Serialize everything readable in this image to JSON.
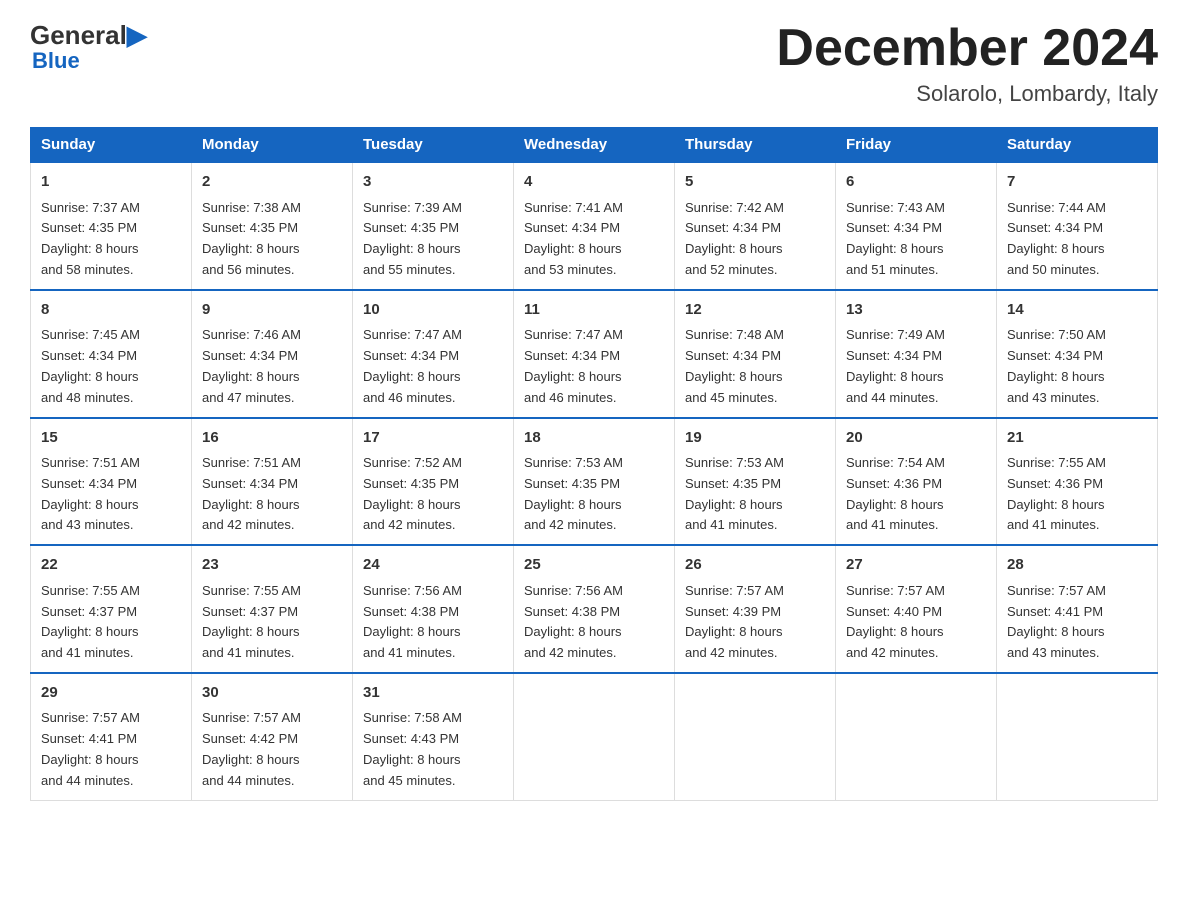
{
  "header": {
    "logo_general": "General",
    "logo_blue": "Blue",
    "month_title": "December 2024",
    "location": "Solarolo, Lombardy, Italy"
  },
  "days_of_week": [
    "Sunday",
    "Monday",
    "Tuesday",
    "Wednesday",
    "Thursday",
    "Friday",
    "Saturday"
  ],
  "weeks": [
    [
      {
        "day": "1",
        "sunrise": "7:37 AM",
        "sunset": "4:35 PM",
        "daylight": "8 hours and 58 minutes."
      },
      {
        "day": "2",
        "sunrise": "7:38 AM",
        "sunset": "4:35 PM",
        "daylight": "8 hours and 56 minutes."
      },
      {
        "day": "3",
        "sunrise": "7:39 AM",
        "sunset": "4:35 PM",
        "daylight": "8 hours and 55 minutes."
      },
      {
        "day": "4",
        "sunrise": "7:41 AM",
        "sunset": "4:34 PM",
        "daylight": "8 hours and 53 minutes."
      },
      {
        "day": "5",
        "sunrise": "7:42 AM",
        "sunset": "4:34 PM",
        "daylight": "8 hours and 52 minutes."
      },
      {
        "day": "6",
        "sunrise": "7:43 AM",
        "sunset": "4:34 PM",
        "daylight": "8 hours and 51 minutes."
      },
      {
        "day": "7",
        "sunrise": "7:44 AM",
        "sunset": "4:34 PM",
        "daylight": "8 hours and 50 minutes."
      }
    ],
    [
      {
        "day": "8",
        "sunrise": "7:45 AM",
        "sunset": "4:34 PM",
        "daylight": "8 hours and 48 minutes."
      },
      {
        "day": "9",
        "sunrise": "7:46 AM",
        "sunset": "4:34 PM",
        "daylight": "8 hours and 47 minutes."
      },
      {
        "day": "10",
        "sunrise": "7:47 AM",
        "sunset": "4:34 PM",
        "daylight": "8 hours and 46 minutes."
      },
      {
        "day": "11",
        "sunrise": "7:47 AM",
        "sunset": "4:34 PM",
        "daylight": "8 hours and 46 minutes."
      },
      {
        "day": "12",
        "sunrise": "7:48 AM",
        "sunset": "4:34 PM",
        "daylight": "8 hours and 45 minutes."
      },
      {
        "day": "13",
        "sunrise": "7:49 AM",
        "sunset": "4:34 PM",
        "daylight": "8 hours and 44 minutes."
      },
      {
        "day": "14",
        "sunrise": "7:50 AM",
        "sunset": "4:34 PM",
        "daylight": "8 hours and 43 minutes."
      }
    ],
    [
      {
        "day": "15",
        "sunrise": "7:51 AM",
        "sunset": "4:34 PM",
        "daylight": "8 hours and 43 minutes."
      },
      {
        "day": "16",
        "sunrise": "7:51 AM",
        "sunset": "4:34 PM",
        "daylight": "8 hours and 42 minutes."
      },
      {
        "day": "17",
        "sunrise": "7:52 AM",
        "sunset": "4:35 PM",
        "daylight": "8 hours and 42 minutes."
      },
      {
        "day": "18",
        "sunrise": "7:53 AM",
        "sunset": "4:35 PM",
        "daylight": "8 hours and 42 minutes."
      },
      {
        "day": "19",
        "sunrise": "7:53 AM",
        "sunset": "4:35 PM",
        "daylight": "8 hours and 41 minutes."
      },
      {
        "day": "20",
        "sunrise": "7:54 AM",
        "sunset": "4:36 PM",
        "daylight": "8 hours and 41 minutes."
      },
      {
        "day": "21",
        "sunrise": "7:55 AM",
        "sunset": "4:36 PM",
        "daylight": "8 hours and 41 minutes."
      }
    ],
    [
      {
        "day": "22",
        "sunrise": "7:55 AM",
        "sunset": "4:37 PM",
        "daylight": "8 hours and 41 minutes."
      },
      {
        "day": "23",
        "sunrise": "7:55 AM",
        "sunset": "4:37 PM",
        "daylight": "8 hours and 41 minutes."
      },
      {
        "day": "24",
        "sunrise": "7:56 AM",
        "sunset": "4:38 PM",
        "daylight": "8 hours and 41 minutes."
      },
      {
        "day": "25",
        "sunrise": "7:56 AM",
        "sunset": "4:38 PM",
        "daylight": "8 hours and 42 minutes."
      },
      {
        "day": "26",
        "sunrise": "7:57 AM",
        "sunset": "4:39 PM",
        "daylight": "8 hours and 42 minutes."
      },
      {
        "day": "27",
        "sunrise": "7:57 AM",
        "sunset": "4:40 PM",
        "daylight": "8 hours and 42 minutes."
      },
      {
        "day": "28",
        "sunrise": "7:57 AM",
        "sunset": "4:41 PM",
        "daylight": "8 hours and 43 minutes."
      }
    ],
    [
      {
        "day": "29",
        "sunrise": "7:57 AM",
        "sunset": "4:41 PM",
        "daylight": "8 hours and 44 minutes."
      },
      {
        "day": "30",
        "sunrise": "7:57 AM",
        "sunset": "4:42 PM",
        "daylight": "8 hours and 44 minutes."
      },
      {
        "day": "31",
        "sunrise": "7:58 AM",
        "sunset": "4:43 PM",
        "daylight": "8 hours and 45 minutes."
      },
      null,
      null,
      null,
      null
    ]
  ],
  "labels": {
    "sunrise": "Sunrise:",
    "sunset": "Sunset:",
    "daylight": "Daylight:"
  }
}
